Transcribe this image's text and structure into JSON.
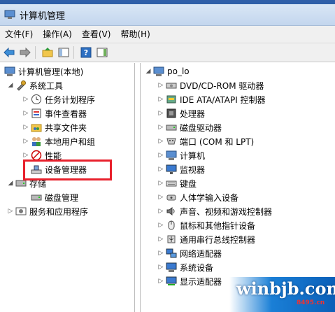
{
  "window": {
    "title": "计算机管理"
  },
  "menu": [
    "文件(F)",
    "操作(A)",
    "查看(V)",
    "帮助(H)"
  ],
  "left_tree": {
    "root": "计算机管理(本地)",
    "system_tools": "系统工具",
    "task_scheduler": "任务计划程序",
    "event_viewer": "事件查看器",
    "shared_folders": "共享文件夹",
    "local_users": "本地用户和组",
    "performance": "性能",
    "device_manager": "设备管理器",
    "storage": "存储",
    "disk_management": "磁盘管理",
    "services_apps": "服务和应用程序"
  },
  "right_tree": {
    "root": "po_lo",
    "devices": [
      "DVD/CD-ROM 驱动器",
      "IDE ATA/ATAPI 控制器",
      "处理器",
      "磁盘驱动器",
      "端口 (COM 和 LPT)",
      "计算机",
      "监视器",
      "键盘",
      "人体学输入设备",
      "声音、视频和游戏控制器",
      "鼠标和其他指针设备",
      "通用串行总线控制器",
      "网络适配器",
      "系统设备",
      "显示适配器"
    ]
  },
  "watermark": {
    "text": "winbjb.com",
    "sub": "8495.cn"
  },
  "colors": {
    "highlight": "#e8202c",
    "titlebar": "#c3d6ee",
    "watermark": "#1a7fd6"
  }
}
